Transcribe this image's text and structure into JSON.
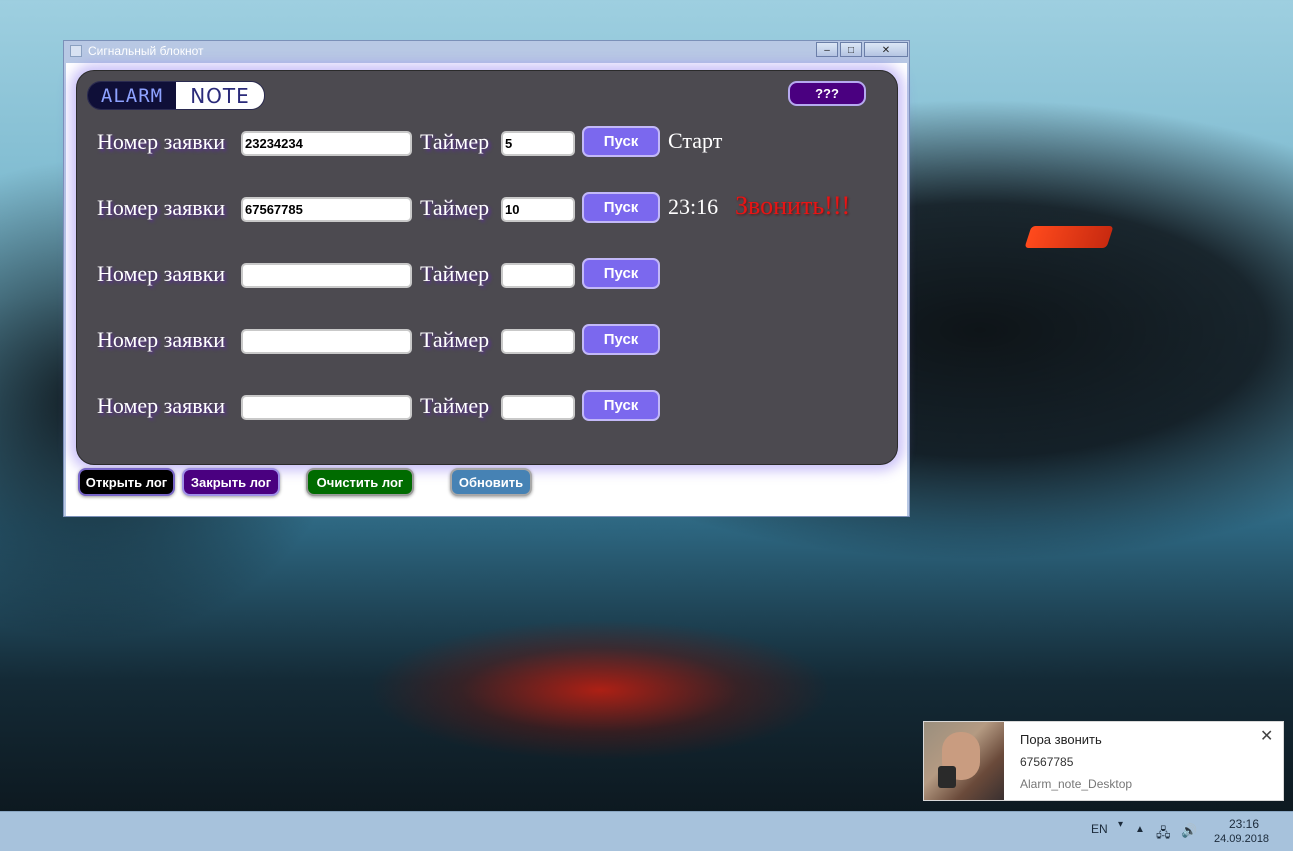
{
  "window": {
    "title": "Сигнальный блокнот",
    "min_glyph": "–",
    "max_glyph": "□",
    "close_glyph": "✕"
  },
  "logo": {
    "part1": "ALARM",
    "part2": "NOTE"
  },
  "help_label": "???",
  "rows": [
    {
      "order_label": "Номер заявки",
      "order_value": "23234234",
      "timer_label": "Таймер",
      "timer_value": "5",
      "start_label": "Пуск",
      "status": "Старт",
      "alert": ""
    },
    {
      "order_label": "Номер заявки",
      "order_value": "67567785",
      "timer_label": "Таймер",
      "timer_value": "10",
      "start_label": "Пуск",
      "status": "23:16",
      "alert": "Звонить!!!"
    },
    {
      "order_label": "Номер заявки",
      "order_value": "",
      "timer_label": "Таймер",
      "timer_value": "",
      "start_label": "Пуск",
      "status": "",
      "alert": ""
    },
    {
      "order_label": "Номер заявки",
      "order_value": "",
      "timer_label": "Таймер",
      "timer_value": "",
      "start_label": "Пуск",
      "status": "",
      "alert": ""
    },
    {
      "order_label": "Номер заявки",
      "order_value": "",
      "timer_label": "Таймер",
      "timer_value": "",
      "start_label": "Пуск",
      "status": "",
      "alert": ""
    }
  ],
  "buttons": {
    "open_log": "Открыть лог",
    "close_log": "Закрыть лог",
    "clear_log": "Очистить лог",
    "refresh": "Обновить"
  },
  "notification": {
    "title": "Пора звонить",
    "body": "67567785",
    "source": "Alarm_note_Desktop",
    "close_glyph": "✕"
  },
  "taskbar": {
    "lang": "EN",
    "time": "23:16",
    "date": "24.09.2018"
  },
  "colors": {
    "panel": "#4c4a50",
    "start_button": "#7b68ee",
    "alert": "#e81414",
    "help_button": "#4a0080",
    "open_log": "#000000",
    "close_log": "#4a0080",
    "clear_log": "#006b00",
    "refresh": "#4682b4"
  }
}
